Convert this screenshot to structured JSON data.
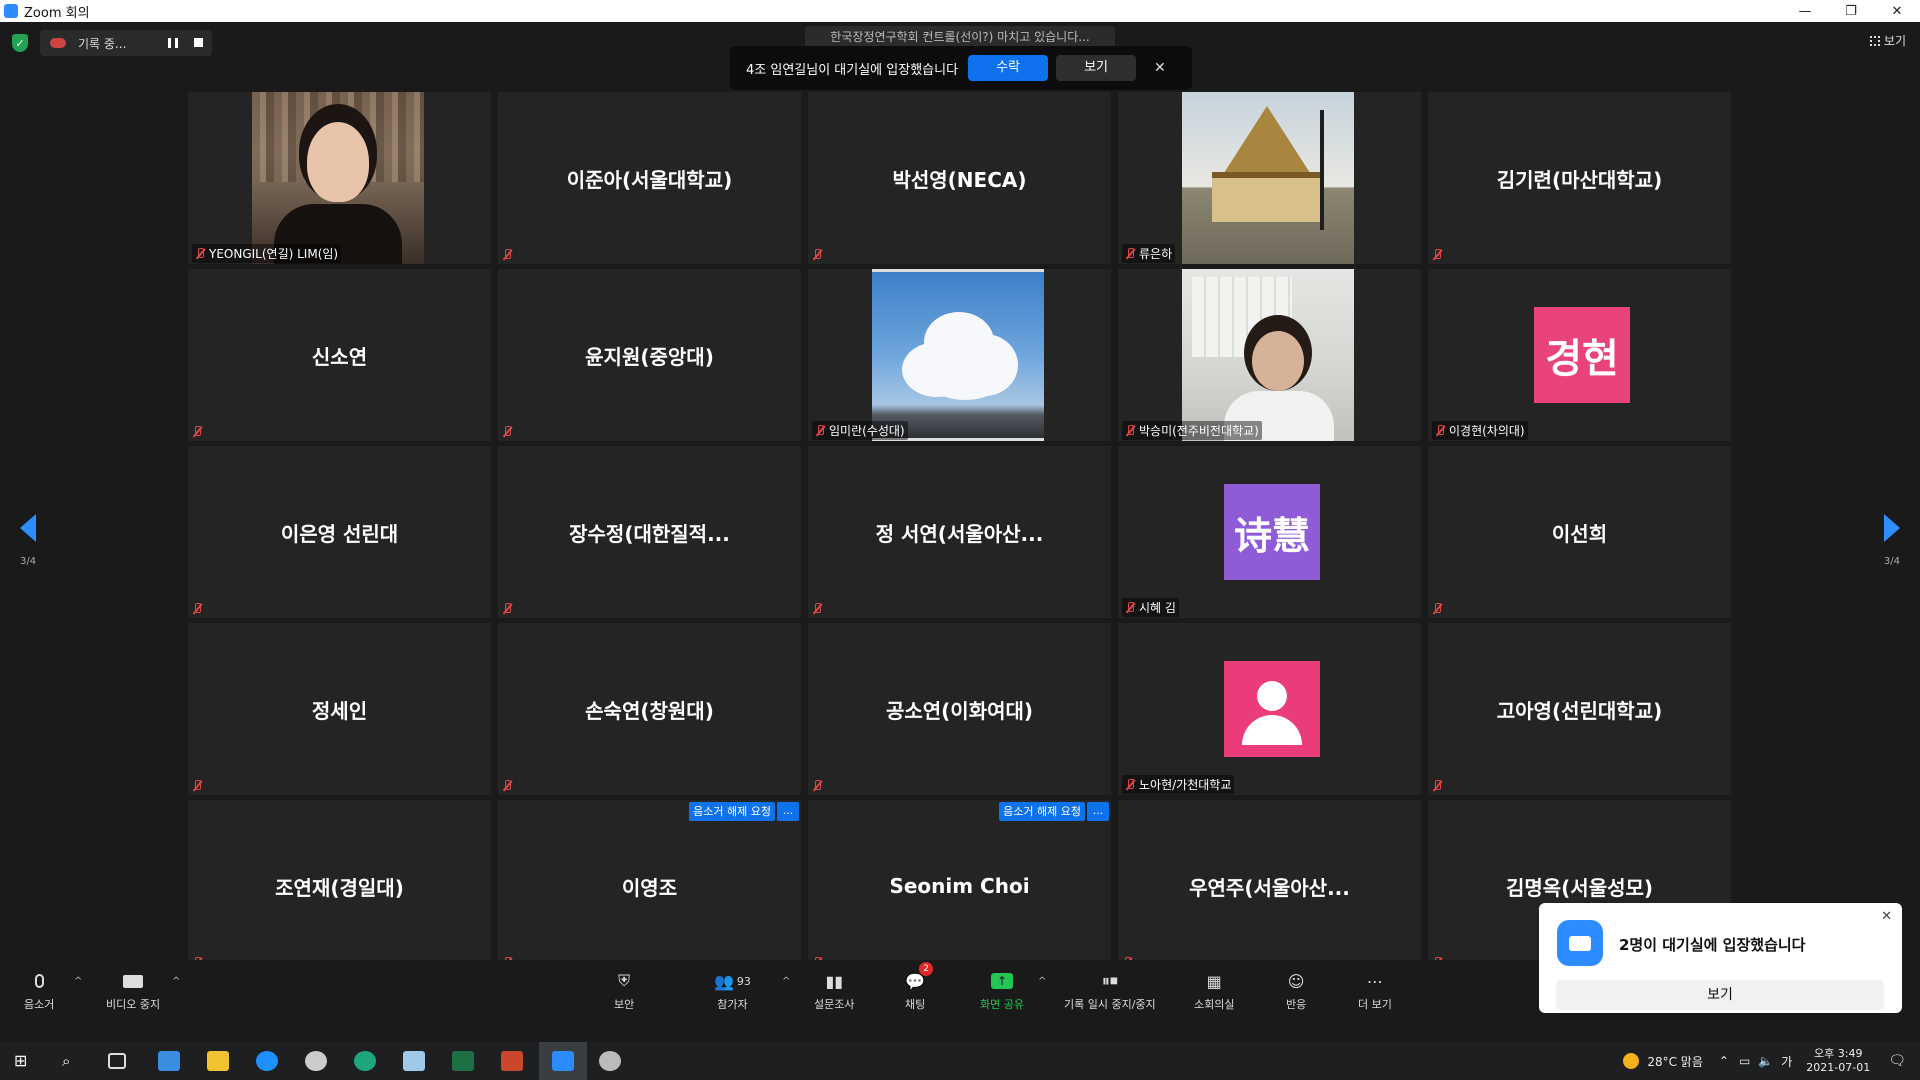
{
  "window": {
    "title": "Zoom 회의",
    "min": "—",
    "restore": "❐",
    "close": "✕"
  },
  "topbar": {
    "recording_label": "기록 중...",
    "view_label": "보기",
    "topic": "한국장정연구학회 컨트롤(선이?) 마치고 있습니다..."
  },
  "notice": {
    "text": "4조 임연길님이 대기실에 입장했습니다",
    "accept": "수락",
    "view": "보기",
    "close": "✕"
  },
  "gallery": {
    "tiles": [
      {
        "name": "YEONGIL(연길) LIM(임)"
      },
      {
        "name": "이준아(서울대학교)"
      },
      {
        "name": "박선영(NECA)"
      },
      {
        "name": "류은하"
      },
      {
        "name": "김기련(마산대학교)"
      },
      {
        "name": "신소연"
      },
      {
        "name": "윤지원(중앙대)"
      },
      {
        "name": "임미란(수성대)"
      },
      {
        "name": "박승미(전주비전대학교)"
      },
      {
        "name": "이경현(차의대)",
        "avatar": "경현"
      },
      {
        "name": "이은영 선린대"
      },
      {
        "name": "장수정(대한질적..."
      },
      {
        "name": "정 서연(서울아산..."
      },
      {
        "name": "시혜 김",
        "avatar": "诗慧"
      },
      {
        "name": "이선희"
      },
      {
        "name": "정세인"
      },
      {
        "name": "손숙연(창원대)"
      },
      {
        "name": "공소연(이화여대)"
      },
      {
        "name": "노아현/가천대학교"
      },
      {
        "name": "고아영(선린대학교)"
      },
      {
        "name": "조연재(경일대)"
      },
      {
        "name": "이영조",
        "request": "음소거 해제 요청",
        "more": "..."
      },
      {
        "name": "Seonim Choi",
        "request": "음소거 해제 요청",
        "more": "..."
      },
      {
        "name": "우연주(서울아산..."
      },
      {
        "name": "김명옥(서울성모)"
      }
    ]
  },
  "pager": {
    "left": "3/4",
    "right": "3/4"
  },
  "toolbar": {
    "mute": "음소거",
    "stop_video": "비디오 중지",
    "security": "보안",
    "participants": "참가자",
    "participants_count": "93",
    "polls": "설문조사",
    "chat": "채팅",
    "chat_badge": "2",
    "share": "화면 공유",
    "rec_pause_stop": "기록 일시 중지/중지",
    "breakout": "소회의실",
    "reactions": "반응",
    "more": "더 보기",
    "caret": "^"
  },
  "popup": {
    "text": "2명이 대기실에 입장했습니다",
    "button": "보기",
    "close": "✕"
  },
  "taskbar": {
    "weather": "28°C  맑음",
    "ime": "가",
    "time": "오후 3:49",
    "date": "2021-07-01"
  },
  "colors": {
    "accent": "#0e72ed",
    "zoom_blue": "#2d8cff",
    "share_green": "#23c554",
    "mute_red": "#e04646"
  }
}
